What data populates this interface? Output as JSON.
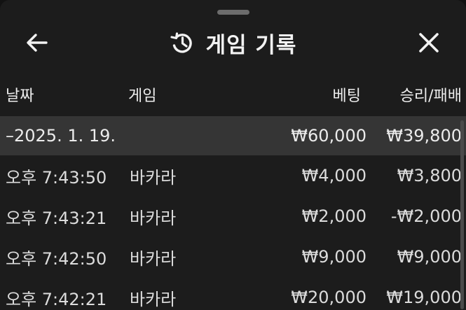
{
  "header": {
    "title": "게임 기록",
    "back_icon": "arrow-left-icon",
    "history_icon": "history-icon",
    "close_icon": "close-icon"
  },
  "columns": {
    "date": "날짜",
    "game": "게임",
    "bet": "베팅",
    "result": "승리/패배"
  },
  "date_group": {
    "label": "–2025. 1. 19.",
    "bet_total": "₩60,000",
    "result_total": "₩39,800"
  },
  "rows": [
    {
      "time": "오후 7:43:50",
      "game": "바카라",
      "bet": "₩4,000",
      "result": "₩3,800"
    },
    {
      "time": "오후 7:43:21",
      "game": "바카라",
      "bet": "₩2,000",
      "result": "-₩2,000"
    },
    {
      "time": "오후 7:42:50",
      "game": "바카라",
      "bet": "₩9,000",
      "result": "₩9,000"
    },
    {
      "time": "오후 7:42:21",
      "game": "바카라",
      "bet": "₩20,000",
      "result": "₩19,000"
    }
  ],
  "colors": {
    "background": "#1c1c1c",
    "date_row": "#353535",
    "text": "#e6e6e6"
  }
}
